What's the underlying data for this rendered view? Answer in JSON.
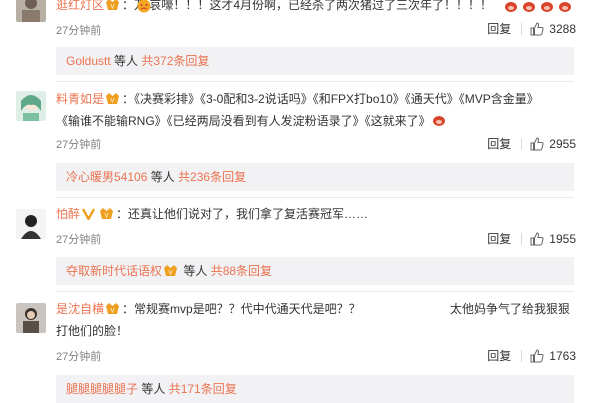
{
  "comments": [
    {
      "username": "逛红灯区",
      "text": "：万     哀嚎！！！这才4月份啊，已经杀了两次猪过了三次年了！！！！",
      "time": "27分钟前",
      "reply_label": "回复",
      "likes": "3288",
      "replies_by": "Goldustt",
      "replies_mid": " 等人 ",
      "replies_count": "共372条回复"
    },
    {
      "username": "料青如是",
      "text_line1": "：《决赛彩排》《3-0配和3-2说话吗》《和FPX打bo10》《通天代》《MVP含金量》",
      "text_line2": "《输谁不能输RNG》《已经两局没看到有人发淀粉语录了》《这就来了》",
      "time": "27分钟前",
      "reply_label": "回复",
      "likes": "2955",
      "replies_by": "冷心暖男54106",
      "replies_mid": " 等人 ",
      "replies_count": "共236条回复"
    },
    {
      "username": "怕醉",
      "text": "：还真让他们说对了，我们拿了复活赛冠军……",
      "time": "27分钟前",
      "reply_label": "回复",
      "likes": "1955",
      "replies_by": "夺取新时代话语权",
      "replies_mid": " 等人 ",
      "replies_count": "共88条回复"
    },
    {
      "username": "是沈自横",
      "text_line1": "：常规赛mvp是吧？？代中代通天代是吧？？",
      "text_right": "太他妈争气了给我狠狠",
      "text_line2": "打他们的脸！",
      "time": "27分钟前",
      "reply_label": "回复",
      "likes": "1763",
      "replies_by": "腿腿腿腿腿子",
      "replies_mid": " 等人 ",
      "replies_count": "共171条回复"
    }
  ],
  "colors": {
    "username": "#eb7350",
    "text": "#333333",
    "time": "#808080",
    "sub_bg": "#f2f2f5"
  }
}
